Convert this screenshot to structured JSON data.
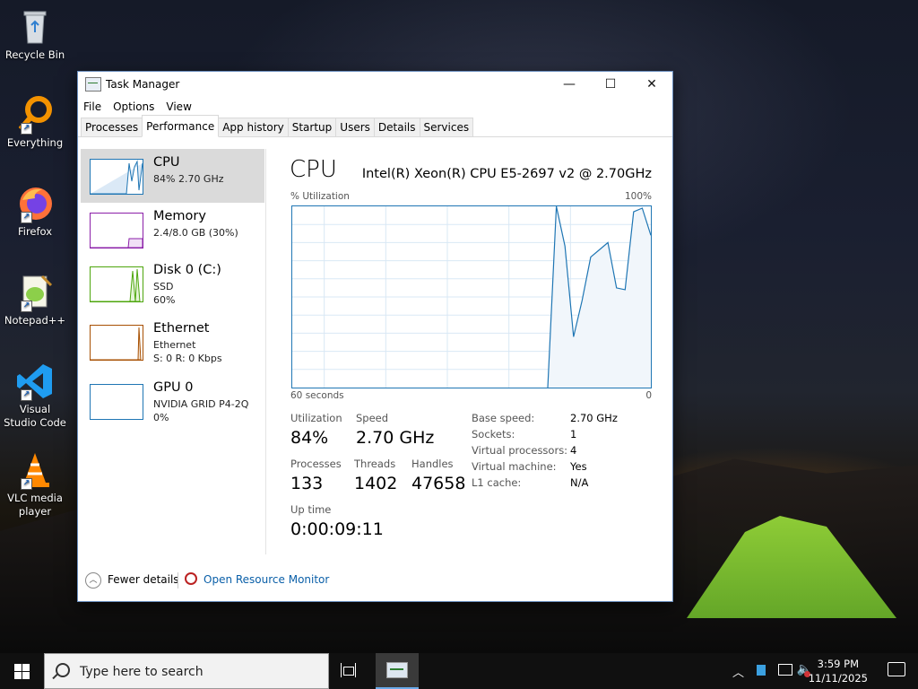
{
  "desktop": {
    "icons": [
      {
        "label": "Recycle Bin"
      },
      {
        "label": "Everything"
      },
      {
        "label": "Firefox"
      },
      {
        "label": "Notepad++"
      },
      {
        "label": "Visual Studio Code"
      },
      {
        "label": "VLC media player"
      }
    ]
  },
  "window": {
    "title": "Task Manager",
    "controls": {
      "minimize": "—",
      "maximize": "☐",
      "close": "✕"
    },
    "menu": [
      "File",
      "Options",
      "View"
    ],
    "tabs": [
      "Processes",
      "Performance",
      "App history",
      "Startup",
      "Users",
      "Details",
      "Services"
    ],
    "active_tab": "Performance"
  },
  "sidebar": {
    "items": [
      {
        "name": "CPU",
        "line1": "84%  2.70 GHz",
        "line2": "",
        "color": "#1f76b4"
      },
      {
        "name": "Memory",
        "line1": "2.4/8.0 GB (30%)",
        "line2": "",
        "color": "#8b1fa8"
      },
      {
        "name": "Disk 0 (C:)",
        "line1": "SSD",
        "line2": "60%",
        "color": "#4da60c"
      },
      {
        "name": "Ethernet",
        "line1": "Ethernet",
        "line2": "S: 0  R: 0 Kbps",
        "color": "#a74f01"
      },
      {
        "name": "GPU 0",
        "line1": "NVIDIA GRID P4-2Q",
        "line2": "0%",
        "color": "#1f76b4"
      }
    ],
    "selected": "CPU"
  },
  "cpu": {
    "title": "CPU",
    "model": "Intel(R) Xeon(R) CPU E5-2697 v2 @ 2.70GHz",
    "graph_label": "% Utilization",
    "graph_max": "100%",
    "graph_time": "60 seconds",
    "graph_min": "0",
    "stats": {
      "utilization_label": "Utilization",
      "utilization": "84%",
      "speed_label": "Speed",
      "speed": "2.70 GHz",
      "processes_label": "Processes",
      "processes": "133",
      "threads_label": "Threads",
      "threads": "1402",
      "handles_label": "Handles",
      "handles": "47658",
      "uptime_label": "Up time",
      "uptime": "0:00:09:11"
    },
    "info": [
      {
        "label": "Base speed:",
        "value": "2.70 GHz"
      },
      {
        "label": "Sockets:",
        "value": "1"
      },
      {
        "label": "Virtual processors:",
        "value": "4"
      },
      {
        "label": "Virtual machine:",
        "value": "Yes"
      },
      {
        "label": "L1 cache:",
        "value": "N/A"
      }
    ],
    "utilization_history": [
      0,
      0,
      0,
      0,
      0,
      0,
      0,
      0,
      0,
      0,
      0,
      0,
      0,
      0,
      0,
      0,
      0,
      0,
      0,
      0,
      0,
      0,
      0,
      0,
      0,
      0,
      0,
      0,
      0,
      0,
      0,
      0,
      0,
      0,
      0,
      0,
      0,
      0,
      0,
      0,
      0,
      0,
      0,
      0,
      0,
      0,
      0,
      0,
      0,
      0,
      0,
      0,
      0,
      0,
      0,
      0,
      0,
      0,
      0,
      0,
      0,
      0,
      0,
      0,
      0,
      0,
      0,
      0,
      0,
      0,
      0,
      0,
      0,
      0,
      0,
      0,
      0,
      0,
      0,
      0,
      0,
      0,
      0,
      0,
      0,
      0,
      0,
      0,
      0,
      0,
      0,
      0,
      0,
      0,
      0,
      0,
      0,
      0,
      0,
      0,
      0,
      0,
      0,
      0,
      0,
      0,
      0,
      0,
      0,
      0,
      0,
      0,
      0,
      0,
      0,
      0,
      0,
      0,
      0,
      0,
      0,
      0,
      0,
      0,
      0,
      0,
      0,
      0,
      0,
      0,
      0,
      0,
      0,
      0,
      0,
      0,
      0,
      0,
      0,
      0,
      0,
      0,
      0,
      0,
      0,
      0,
      0,
      0,
      0,
      0,
      0,
      0,
      0,
      0,
      0,
      0,
      0,
      0,
      0,
      0,
      0,
      0,
      0,
      0,
      0,
      0,
      0,
      0,
      0,
      0,
      0,
      0,
      0,
      0,
      0,
      0,
      0,
      0,
      0,
      0,
      0,
      0,
      0,
      0,
      0,
      0,
      0,
      0,
      0,
      0,
      0,
      0,
      0,
      0,
      0,
      0,
      0,
      0,
      0,
      0,
      0,
      0,
      0,
      0,
      0,
      0,
      0,
      0,
      0,
      0,
      0,
      0,
      0,
      0,
      0,
      0,
      0,
      0,
      0,
      0,
      0,
      0,
      0,
      0,
      0,
      0,
      0,
      0,
      0,
      0,
      0,
      0,
      0,
      0,
      0,
      0,
      0,
      0,
      0,
      0,
      0,
      0,
      0,
      0,
      0,
      0,
      0,
      0,
      0,
      0,
      0,
      0,
      0,
      0,
      0,
      0,
      0,
      0,
      0,
      0,
      0,
      0,
      0,
      0,
      0,
      0,
      0,
      0,
      0,
      0,
      0,
      0,
      0,
      0,
      0,
      0,
      0,
      0,
      0,
      0,
      0,
      0,
      0,
      0,
      0,
      0,
      0,
      0,
      0,
      0,
      0,
      0,
      0,
      0,
      0
    ],
    "utilization_recent": [
      0,
      100,
      78,
      28,
      48,
      72,
      76,
      80,
      55,
      54,
      97,
      99,
      84
    ]
  },
  "footer": {
    "fewer_details": "Fewer details",
    "open_resource_monitor": "Open Resource Monitor"
  },
  "taskbar": {
    "search_placeholder": "Type here to search",
    "time": "3:59 PM",
    "date": "11/11/2025"
  }
}
